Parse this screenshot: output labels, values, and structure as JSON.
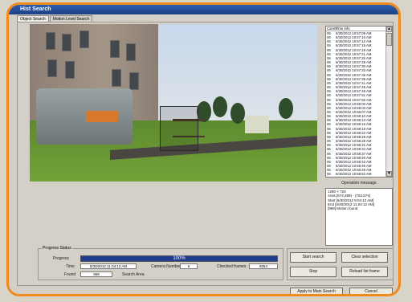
{
  "window": {
    "title": "Hist Search"
  },
  "tabs": [
    {
      "label": "Object Search"
    },
    {
      "label": "Motion Level Search"
    }
  ],
  "camera_list": {
    "headers": {
      "cam": "CamN",
      "time": "Time info"
    },
    "rows": [
      {
        "cam": "06",
        "time": "6/30/2012 10:57:09 AM"
      },
      {
        "cam": "06",
        "time": "6/30/2012 10:57:10 AM"
      },
      {
        "cam": "06",
        "time": "6/30/2012 10:57:12 AM"
      },
      {
        "cam": "06",
        "time": "6/30/2012 10:57:15 AM"
      },
      {
        "cam": "06",
        "time": "6/30/2012 10:57:19 AM"
      },
      {
        "cam": "06",
        "time": "6/30/2012 10:57:21 AM"
      },
      {
        "cam": "06",
        "time": "6/30/2012 10:57:26 AM"
      },
      {
        "cam": "06",
        "time": "6/30/2012 10:57:28 AM"
      },
      {
        "cam": "06",
        "time": "6/30/2012 10:57:30 AM"
      },
      {
        "cam": "06",
        "time": "6/30/2012 10:57:33 AM"
      },
      {
        "cam": "06",
        "time": "6/30/2012 10:57:36 AM"
      },
      {
        "cam": "06",
        "time": "6/30/2012 10:57:38 AM"
      },
      {
        "cam": "06",
        "time": "6/30/2012 10:57:41 AM"
      },
      {
        "cam": "06",
        "time": "6/30/2012 10:57:45 AM"
      },
      {
        "cam": "06",
        "time": "6/30/2012 10:57:48 AM"
      },
      {
        "cam": "06",
        "time": "6/30/2012 10:57:51 AM"
      },
      {
        "cam": "06",
        "time": "6/30/2012 10:57:55 AM"
      },
      {
        "cam": "06",
        "time": "6/30/2012 10:58:00 AM"
      },
      {
        "cam": "06",
        "time": "6/30/2012 10:58:03 AM"
      },
      {
        "cam": "06",
        "time": "6/30/2012 10:58:07 AM"
      },
      {
        "cam": "06",
        "time": "6/30/2012 10:58:10 AM"
      },
      {
        "cam": "06",
        "time": "6/30/2012 10:58:13 AM"
      },
      {
        "cam": "06",
        "time": "6/30/2012 10:58:16 AM"
      },
      {
        "cam": "06",
        "time": "6/30/2012 10:58:19 AM"
      },
      {
        "cam": "06",
        "time": "6/30/2012 10:58:22 AM"
      },
      {
        "cam": "06",
        "time": "6/30/2012 10:58:25 AM"
      },
      {
        "cam": "06",
        "time": "6/30/2012 10:58:28 AM"
      },
      {
        "cam": "06",
        "time": "6/30/2012 10:58:31 AM"
      },
      {
        "cam": "06",
        "time": "6/30/2012 10:58:34 AM"
      },
      {
        "cam": "06",
        "time": "6/30/2012 10:58:37 AM"
      },
      {
        "cam": "06",
        "time": "6/30/2012 10:58:40 AM"
      },
      {
        "cam": "06",
        "time": "6/30/2012 10:58:43 AM"
      },
      {
        "cam": "06",
        "time": "6/30/2012 10:58:46 AM"
      },
      {
        "cam": "06",
        "time": "6/30/2012 10:58:49 AM"
      },
      {
        "cam": "06",
        "time": "6/30/2012 10:58:52 AM"
      },
      {
        "cam": "06",
        "time": "6/30/2012 10:58:55 AM"
      }
    ]
  },
  "operation": {
    "label": "Operation message",
    "lines": [
      "1280 × 720",
      "Area:(574,289) - (752,574)",
      "Start [6/30/2012 9:04:12 AM]",
      "End [6/30/2012 11:04:12 AM]",
      "[969] Motion found"
    ]
  },
  "progress": {
    "group_title": "Progress Status",
    "progress_label": "Progress",
    "percent": 100,
    "percent_text": "100%",
    "time_label": "Time",
    "time_value": "6/30/2012 11:04:12 AM",
    "camera_number_label": "Camera Number",
    "camera_number_value": "6",
    "checked_frames_label": "Checked frames",
    "checked_frames_value": "6064",
    "found_label": "Found",
    "found_value": "969",
    "search_area_label": "Search Area"
  },
  "buttons": {
    "start_search": "Start search",
    "clear_selection": "Clear selection",
    "stop": "Stop",
    "reload_list_frame": "Reload list frame",
    "apply": "Apply to Main Search",
    "cancel": "Cancel"
  },
  "colors": {
    "frame_accent": "#f08a1c",
    "progress_fill": "#203c8e"
  },
  "icons": {
    "scroll_up": "▲",
    "scroll_down": "▼"
  }
}
